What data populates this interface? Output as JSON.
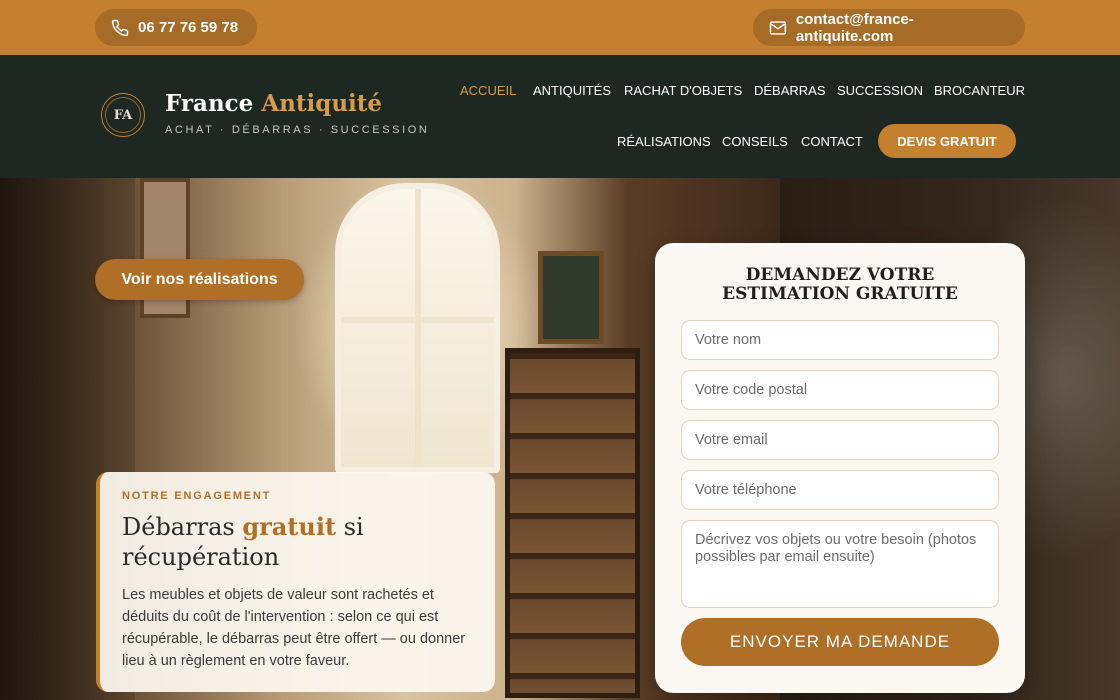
{
  "topbar": {
    "phone": "06 77 76 59 78",
    "phone_icon": "phone-icon",
    "email": "contact@france-antiquite.com",
    "email_icon": "mail-icon"
  },
  "brand": {
    "badge": "FA",
    "name_part1": "France",
    "name_part2": "Antiquité",
    "tagline": "ACHAT · DÉBARRAS · SUCCESSION"
  },
  "nav": {
    "row1": [
      "ACCUEIL",
      "ANTIQUITÉS",
      "RACHAT D'OBJETS",
      "DÉBARRAS",
      "SUCCESSION",
      "BROCANTEUR"
    ],
    "row2": [
      "RÉALISATIONS",
      "CONSEILS",
      "CONTACT"
    ],
    "active": "ACCUEIL",
    "cta": "DEVIS GRATUIT"
  },
  "hero": {
    "secondary_button": "Voir nos réalisations",
    "card": {
      "kicker": "NOTRE ENGAGEMENT",
      "title_part1": "Débarras",
      "title_accent": "gratuit",
      "title_part2": "si récupération",
      "text": "Les meubles et objets de valeur sont rachetés et déduits du coût de l'intervention : selon ce qui est récupérable, le débarras peut être offert — ou donner lieu à un règlement en votre faveur."
    }
  },
  "form": {
    "title": "DEMANDEZ VOTRE ESTIMATION GRATUITE",
    "name_placeholder": "Votre nom",
    "postal_placeholder": "Votre code postal",
    "email_placeholder": "Votre email",
    "phone_placeholder": "Votre téléphone",
    "message_placeholder": "Décrivez vos objets ou votre besoin (photos possibles par email ensuite)",
    "submit": "ENVOYER MA DEMANDE"
  },
  "colors": {
    "accent": "#c4802f",
    "header_bg": "#1d2823",
    "button_dark": "#b06f27"
  }
}
